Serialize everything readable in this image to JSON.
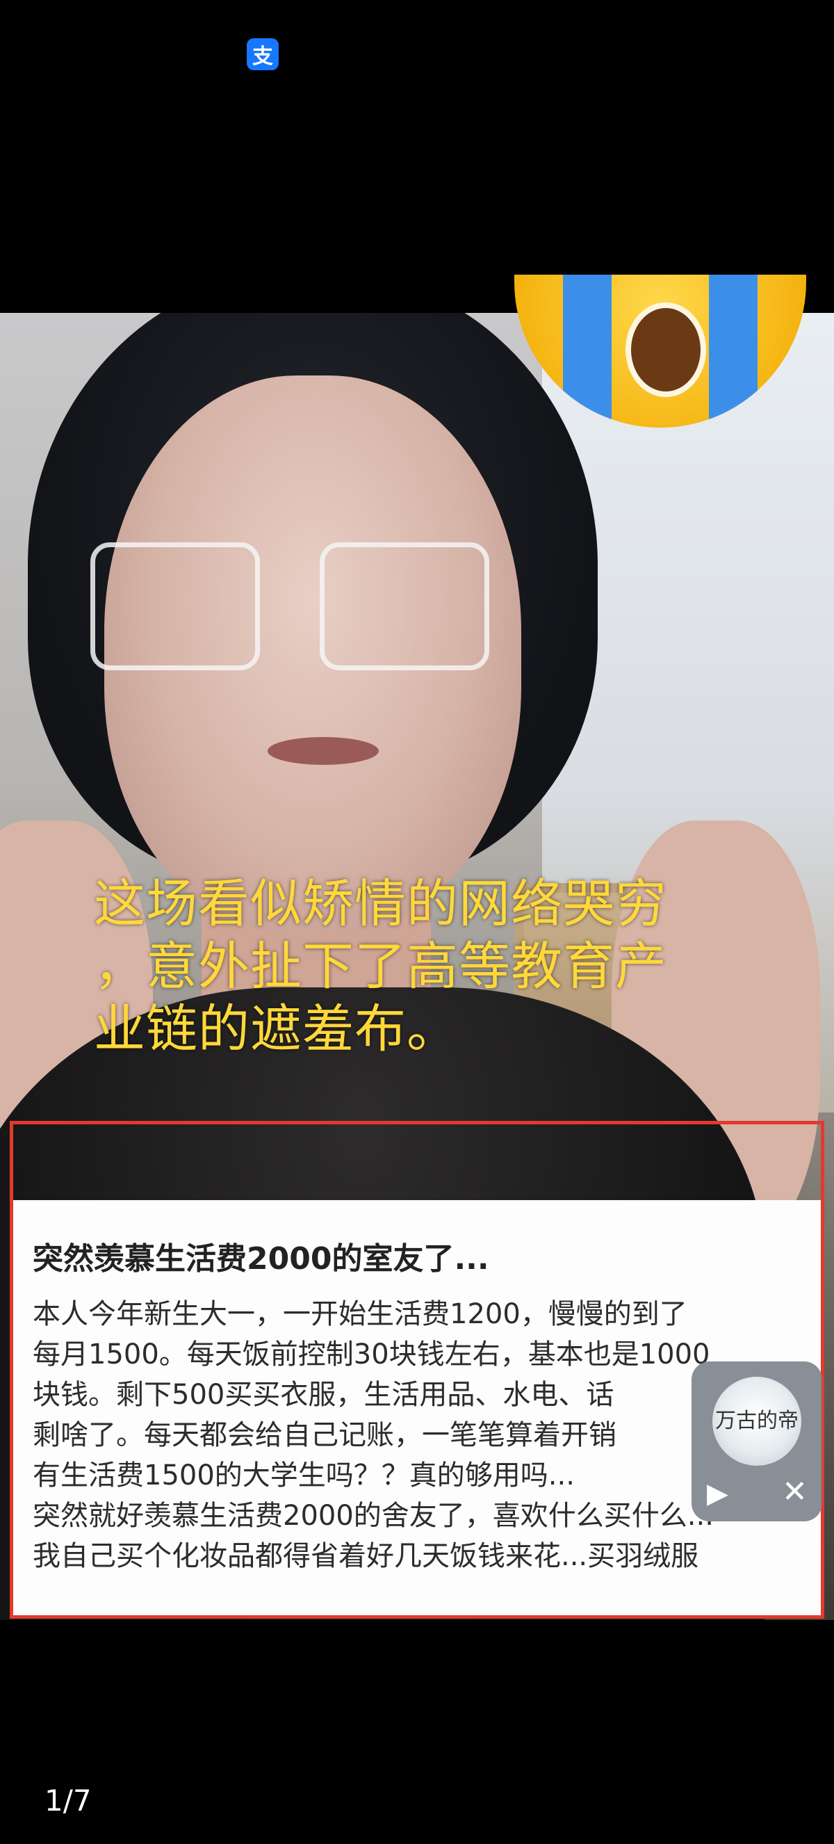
{
  "top_bar": {
    "app_badge_glyph": "支",
    "app_icon": "alipay-icon"
  },
  "image": {
    "caption": "这场看似矫情的网络哭穷，意外扯下了高等教育产业链的遮羞布。",
    "caption_lines": [
      "这场看似矫情的网络哭穷",
      "，意外扯下了高等教育产",
      "业链的遮羞布。"
    ],
    "highlight_color": "#e23a2c",
    "caption_color": "#ffd83a"
  },
  "post": {
    "title": "突然羡慕生活费2000的室友了...",
    "lines": [
      "本人今年新生大一，一开始生活费1200，慢慢的到了",
      "每月1500。每天饭前控制30块钱左右，基本也是1000",
      "块钱。剩下500买买衣服，生活用品、水电、话",
      "剩啥了。每天都会给自己记账，一笔笔算着开销",
      "有生活费1500的大学生吗？？真的够用吗...",
      "突然就好羡慕生活费2000的舍友了，喜欢什么买什么...",
      "我自己买个化妆品都得省着好几天饭钱来花...买羽绒服"
    ]
  },
  "floating_player": {
    "avatar_text": "万古的帝",
    "play_icon": "play-icon",
    "close_icon": "close-icon"
  },
  "footer": {
    "page_counter": "1/7"
  }
}
